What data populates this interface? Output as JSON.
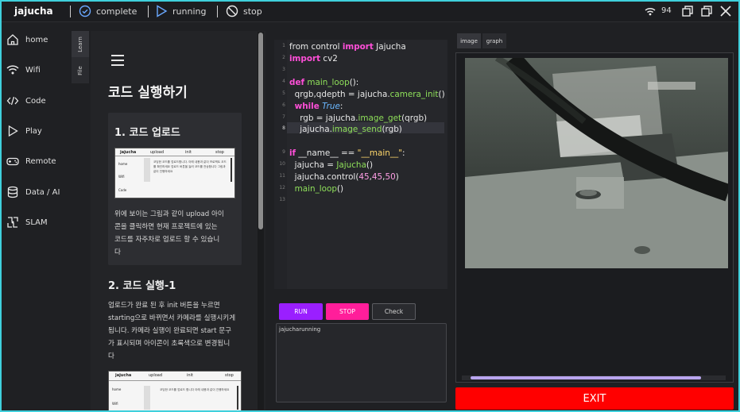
{
  "topbar": {
    "brand": "jajucha",
    "status_complete": "complete",
    "status_running": "running",
    "status_stop": "stop",
    "battery": "94"
  },
  "nav": {
    "items": [
      {
        "label": "home",
        "icon": "home-icon"
      },
      {
        "label": "Wifi",
        "icon": "wifi-icon"
      },
      {
        "label": "Code",
        "icon": "code-icon"
      },
      {
        "label": "Play",
        "icon": "play-icon"
      },
      {
        "label": "Remote",
        "icon": "gamepad-icon"
      },
      {
        "label": "Data / AI",
        "icon": "database-icon"
      },
      {
        "label": "SLAM",
        "icon": "slam-icon"
      }
    ]
  },
  "side_tabs": [
    "Learn",
    "File"
  ],
  "learn": {
    "title": "코드 실행하기",
    "section1_title": "1. 코드 업로드",
    "section1_body": [
      "위에 보이는 그림과 같이 upload 아이",
      "콘을 클릭하면 현재 프로젝트에 있는",
      "코드를 자주차로 업로드 할 수 있습니",
      "다"
    ],
    "section2_title": "2. 코드 실행-1",
    "section2_body": [
      "업로드가 완료 된 후 init 버튼을 누르면",
      "starting으로 바뀌면서 카메라를 실행시키게",
      "됩니다. 카메라 실행이 완료되면 start 문구",
      "가 표시되며 아이콘이 초록색으로 변경됩니",
      "다"
    ],
    "thumb": {
      "brand": "jajucha",
      "upload": "upload",
      "init": "init",
      "stop": "stop",
      "home": "home",
      "wifi": "Wifi",
      "code": "Code",
      "line1": "1",
      "line2": "2",
      "text": "코딩한 코드를 업로드합니다. 아래 내용과 같이 프로젝트 코드를 확인하세요 업로드 버튼을 눌러 코드를 전송합니다 그림과 같이 진행하세요",
      "text2": "코딩한 코드를 업로드 합니다 아래 내용과 같이 진행하세요"
    }
  },
  "editor": {
    "line_numbers": [
      "1",
      "2",
      "3",
      "4",
      "5",
      "6",
      "7",
      "8",
      "9",
      "10",
      "11",
      "12",
      "13"
    ]
  },
  "buttons": {
    "run": "RUN",
    "stop": "STOP",
    "check": "Check",
    "exit": "EXIT"
  },
  "console": {
    "output": "jajucharunning"
  },
  "panel_tabs": {
    "image": "image",
    "graph": "graph"
  },
  "colors": {
    "run": "#9a1fff",
    "stop": "#ff1e9a",
    "exit": "#ff0000",
    "keyword": "#ff4fd8",
    "function": "#8fe05a",
    "scrollbar": "#b9a5ef"
  }
}
